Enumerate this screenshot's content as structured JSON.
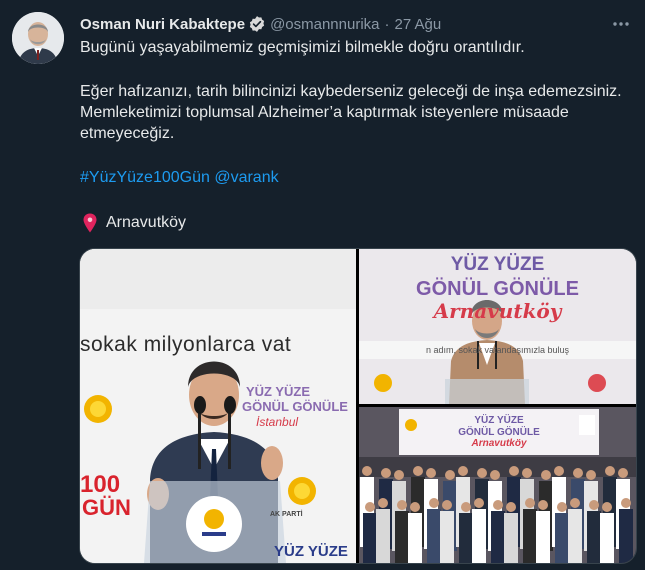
{
  "tweet": {
    "author_name": "Osman Nuri Kabaktepe",
    "handle": "@osmannnurika",
    "separator": "·",
    "time": "27 Ağu",
    "text_line1": "Bugünü yaşayabilmemiz geçmişimizi bilmekle doğru orantılıdır.",
    "text_para2_line1": "Eğer hafızanızı, tarih bilincinizi kaybederseniz geleceği de inşa edemezsiniz.",
    "text_para2_line2": "Memleketimizi toplumsal Alzheimer’a kaptırmak isteyenlere müsaade",
    "text_para2_line3": "etmeyeceğiz.",
    "hashtag": "#YüzYüze100Gün",
    "mention": "@varank",
    "location": "Arnavutköy"
  },
  "media": {
    "left_image": {
      "banner_text": "sokak milyonlarca vat",
      "logo_line1": "YÜZ YÜZE",
      "logo_line2": "GÖNÜL GÖNÜLE",
      "logo_line3": "İstanbul",
      "number": "100",
      "gun": "GÜN",
      "party": "AK PARTİ",
      "bottom": "YÜZ YÜZE"
    },
    "top_right_image": {
      "line1": "YÜZ YÜZE",
      "line2": "GÖNÜL GÖNÜLE",
      "line3": "Arnavutköy",
      "strip": "n adım, sokak                vatandaşımızla buluş"
    },
    "bottom_right_image": {
      "line1": "YÜZ YÜZE",
      "line2": "GÖNÜL GÖNÜLE",
      "line3": "Arnavutköy"
    }
  },
  "colors": {
    "background": "#15202b",
    "text": "#e7e9ea",
    "muted": "#8b98a5",
    "link": "#1d9bf0",
    "verified": "#d9d9d9"
  },
  "icons": {
    "verified": "verified-badge-icon",
    "more": "more-dots-icon",
    "location": "location-pin-icon"
  }
}
